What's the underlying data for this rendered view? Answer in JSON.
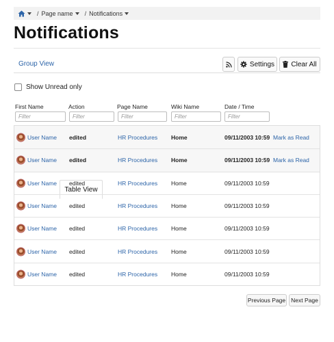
{
  "breadcrumb": {
    "home_icon": "home-icon",
    "separator": "/",
    "page_name": "Page name",
    "current": "Notifications"
  },
  "page_title": "Notifications",
  "tabs": [
    {
      "label": "Group View",
      "active": false
    },
    {
      "label": "Table View",
      "active": true
    }
  ],
  "toolbar": {
    "rss_icon": "rss-icon",
    "settings_label": "Settings",
    "clear_all_label": "Clear All"
  },
  "filter_toggle": {
    "label": "Show Unread only",
    "checked": false
  },
  "columns": [
    {
      "label": "First Name",
      "filter_placeholder": "Filter"
    },
    {
      "label": "Action",
      "filter_placeholder": "Filter"
    },
    {
      "label": "Page Name",
      "filter_placeholder": "Filter"
    },
    {
      "label": "Wiki Name",
      "filter_placeholder": "Filter"
    },
    {
      "label": "Date / Time",
      "filter_placeholder": "Filter"
    }
  ],
  "rows": [
    {
      "user": "User Name",
      "action": "edited",
      "page": "HR Procedures",
      "wiki": "Home",
      "date": "09/11/2003 10:59",
      "unread": true,
      "mark_label": "Mark as Read"
    },
    {
      "user": "User Name",
      "action": "edited",
      "page": "HR Procedures",
      "wiki": "Home",
      "date": "09/11/2003 10:59",
      "unread": true,
      "mark_label": "Mark as Read"
    },
    {
      "user": "User Name",
      "action": "edited",
      "page": "HR Procedures",
      "wiki": "Home",
      "date": "09/11/2003 10:59",
      "unread": false,
      "mark_label": ""
    },
    {
      "user": "User Name",
      "action": "edited",
      "page": "HR Procedures",
      "wiki": "Home",
      "date": "09/11/2003 10:59",
      "unread": false,
      "mark_label": ""
    },
    {
      "user": "User Name",
      "action": "edited",
      "page": "HR Procedures",
      "wiki": "Home",
      "date": "09/11/2003 10:59",
      "unread": false,
      "mark_label": ""
    },
    {
      "user": "User Name",
      "action": "edited",
      "page": "HR Procedures",
      "wiki": "Home",
      "date": "09/11/2003 10:59",
      "unread": false,
      "mark_label": ""
    },
    {
      "user": "User Name",
      "action": "edited",
      "page": "HR Procedures",
      "wiki": "Home",
      "date": "09/11/2003 10:59",
      "unread": false,
      "mark_label": ""
    }
  ],
  "pager": {
    "previous_label": "Previous Page",
    "next_label": "Next Page"
  },
  "colors": {
    "link": "#2c64a8",
    "unread_row_bg": "#f7f7f7",
    "breadcrumb_bg": "#f2f2f2"
  }
}
